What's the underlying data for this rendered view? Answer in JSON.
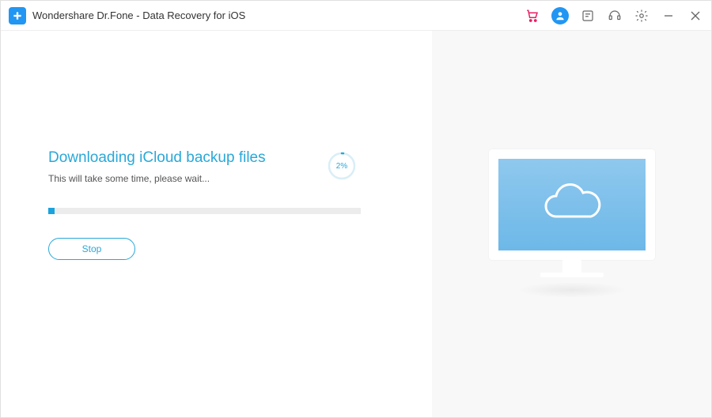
{
  "titlebar": {
    "title": "Wondershare Dr.Fone - Data Recovery for iOS"
  },
  "icons": {
    "cart": "cart-icon",
    "account": "account-icon",
    "feedback": "feedback-icon",
    "support": "support-icon",
    "settings": "settings-icon",
    "minimize": "minimize-icon",
    "close": "close-icon"
  },
  "main": {
    "heading": "Downloading iCloud backup files",
    "subtext": "This will take some time, please wait...",
    "progress_percent": 2,
    "progress_label": "2%",
    "stop_label": "Stop"
  },
  "colors": {
    "accent": "#29a8d8",
    "cart": "#e91e63",
    "account_bg": "#2196F3",
    "progress_track": "#ececec",
    "right_bg": "#f8f8f8"
  }
}
